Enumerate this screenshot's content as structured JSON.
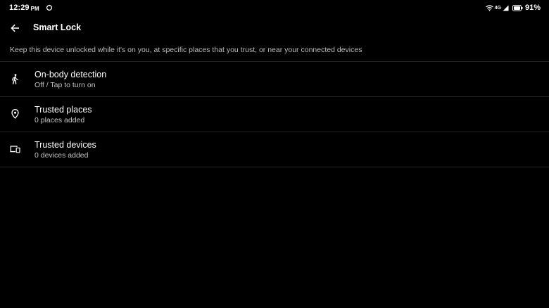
{
  "status_bar": {
    "time": "12:29",
    "ampm": "PM",
    "network": "4G",
    "battery": "91%",
    "icons": [
      "sync-icon",
      "wifi-icon",
      "signal-icon",
      "battery-icon"
    ]
  },
  "app_bar": {
    "back_icon": "arrow-left-icon",
    "title": "Smart Lock"
  },
  "description": "Keep this device unlocked while it's on you, at specific places that you trust, or near your connected devices",
  "items": [
    {
      "icon": "walking-person-icon",
      "title": "On-body detection",
      "subtitle": "Off / Tap to turn on"
    },
    {
      "icon": "location-pin-icon",
      "title": "Trusted places",
      "subtitle": "0 places added"
    },
    {
      "icon": "devices-icon",
      "title": "Trusted devices",
      "subtitle": "0 devices added"
    }
  ],
  "colors": {
    "background": "#000000",
    "text_primary": "#ffffff",
    "text_secondary": "#c4c4c4",
    "divider": "#242424"
  }
}
